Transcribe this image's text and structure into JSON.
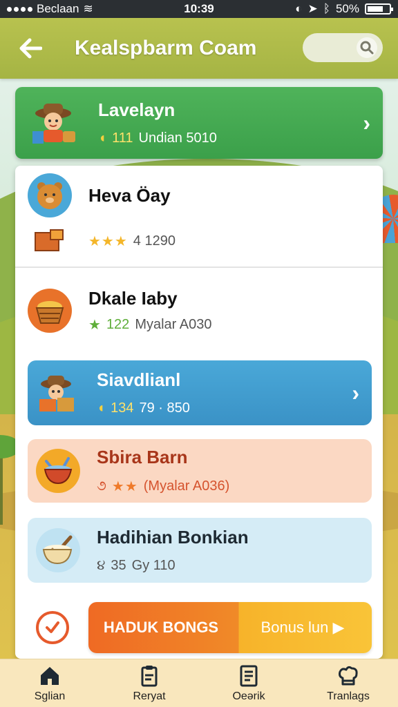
{
  "status_bar": {
    "carrier": "Beclaan",
    "time": "10:39",
    "battery": "50%"
  },
  "header": {
    "title": "Kealspbarm Coam",
    "back_icon": "arrow-left-icon",
    "search_icon": "search-icon"
  },
  "top_card": {
    "name": "Lavelayn",
    "stat": "111",
    "detail": "Undian 5010"
  },
  "list": [
    {
      "name": "Heva Öay",
      "stars": "★★★",
      "stat": "4 1290"
    },
    {
      "name": "Dkale Iaby",
      "stat_prefix": "★",
      "stat": "122",
      "detail": "Myalar A030"
    },
    {
      "name": "Siavdlianl",
      "stat": "134",
      "detail": "79 · 850"
    },
    {
      "name": "Sbira Barn",
      "stars": "★★",
      "detail": "(Myalar A036)"
    },
    {
      "name": "Hadihian Bonkian",
      "stat": "35",
      "detail": "Gy 110"
    }
  ],
  "bonus": {
    "left_label": "HADUK BONGS",
    "right_label": "Bonus lun ▶"
  },
  "tabs": [
    {
      "label": "Sglian",
      "icon": "home-icon"
    },
    {
      "label": "Reryat",
      "icon": "clipboard-icon"
    },
    {
      "label": "Oeərik",
      "icon": "document-icon"
    },
    {
      "label": "Tranlags",
      "icon": "chef-hat-icon"
    }
  ],
  "colors": {
    "header": "#b8c24f",
    "top_card": "#4fb35a",
    "blue_row": "#4aa8d8",
    "peach_row": "#fbd8c3",
    "light_row": "#d5ecf6",
    "bonus_orange": "#ef6a24",
    "bonus_yellow": "#f7b32a"
  }
}
